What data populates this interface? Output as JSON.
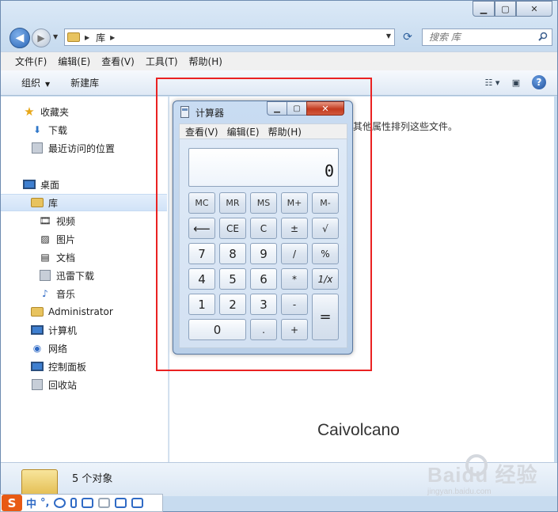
{
  "explorer": {
    "address": "库",
    "search_placeholder": "搜索 库",
    "menu": [
      "文件(F)",
      "编辑(E)",
      "查看(V)",
      "工具(T)",
      "帮助(H)"
    ],
    "toolbar": {
      "organize": "组织",
      "new_library": "新建库"
    },
    "nav": {
      "favorites": "收藏夹",
      "downloads": "下载",
      "recent": "最近访问的位置",
      "desktop": "桌面",
      "library": "库",
      "videos": "视频",
      "pictures": "图片",
      "documents": "文档",
      "xunlei": "迅雷下载",
      "music": "音乐",
      "administrator": "Administrator",
      "computer": "计算机",
      "network": "网络",
      "control_panel": "控制面板",
      "recycle_bin": "回收站"
    },
    "content_hint": "其他属性排列这些文件。",
    "status": "5 个对象",
    "author_watermark": "Caivolcano"
  },
  "calculator": {
    "title": "计算器",
    "menu": [
      "查看(V)",
      "编辑(E)",
      "帮助(H)"
    ],
    "display": "0",
    "keys": {
      "mc": "MC",
      "mr": "MR",
      "ms": "MS",
      "mplus": "M+",
      "mminus": "M-",
      "back": "⟵",
      "ce": "CE",
      "c": "C",
      "plusminus": "±",
      "sqrt": "√",
      "d7": "7",
      "d8": "8",
      "d9": "9",
      "div": "/",
      "pct": "%",
      "d4": "4",
      "d5": "5",
      "d6": "6",
      "mul": "*",
      "recip": "1/x",
      "d1": "1",
      "d2": "2",
      "d3": "3",
      "minus": "-",
      "equals": "=",
      "d0": "0",
      "dot": ".",
      "plus": "+"
    }
  },
  "ime": {
    "lang": "中",
    "punct": "°,"
  },
  "baidu": {
    "logo": "Baidu 经验",
    "url": "jingyan.baidu.com"
  },
  "colors": {
    "highlight_box": "#ea2222",
    "accent": "#2f6ac5"
  }
}
